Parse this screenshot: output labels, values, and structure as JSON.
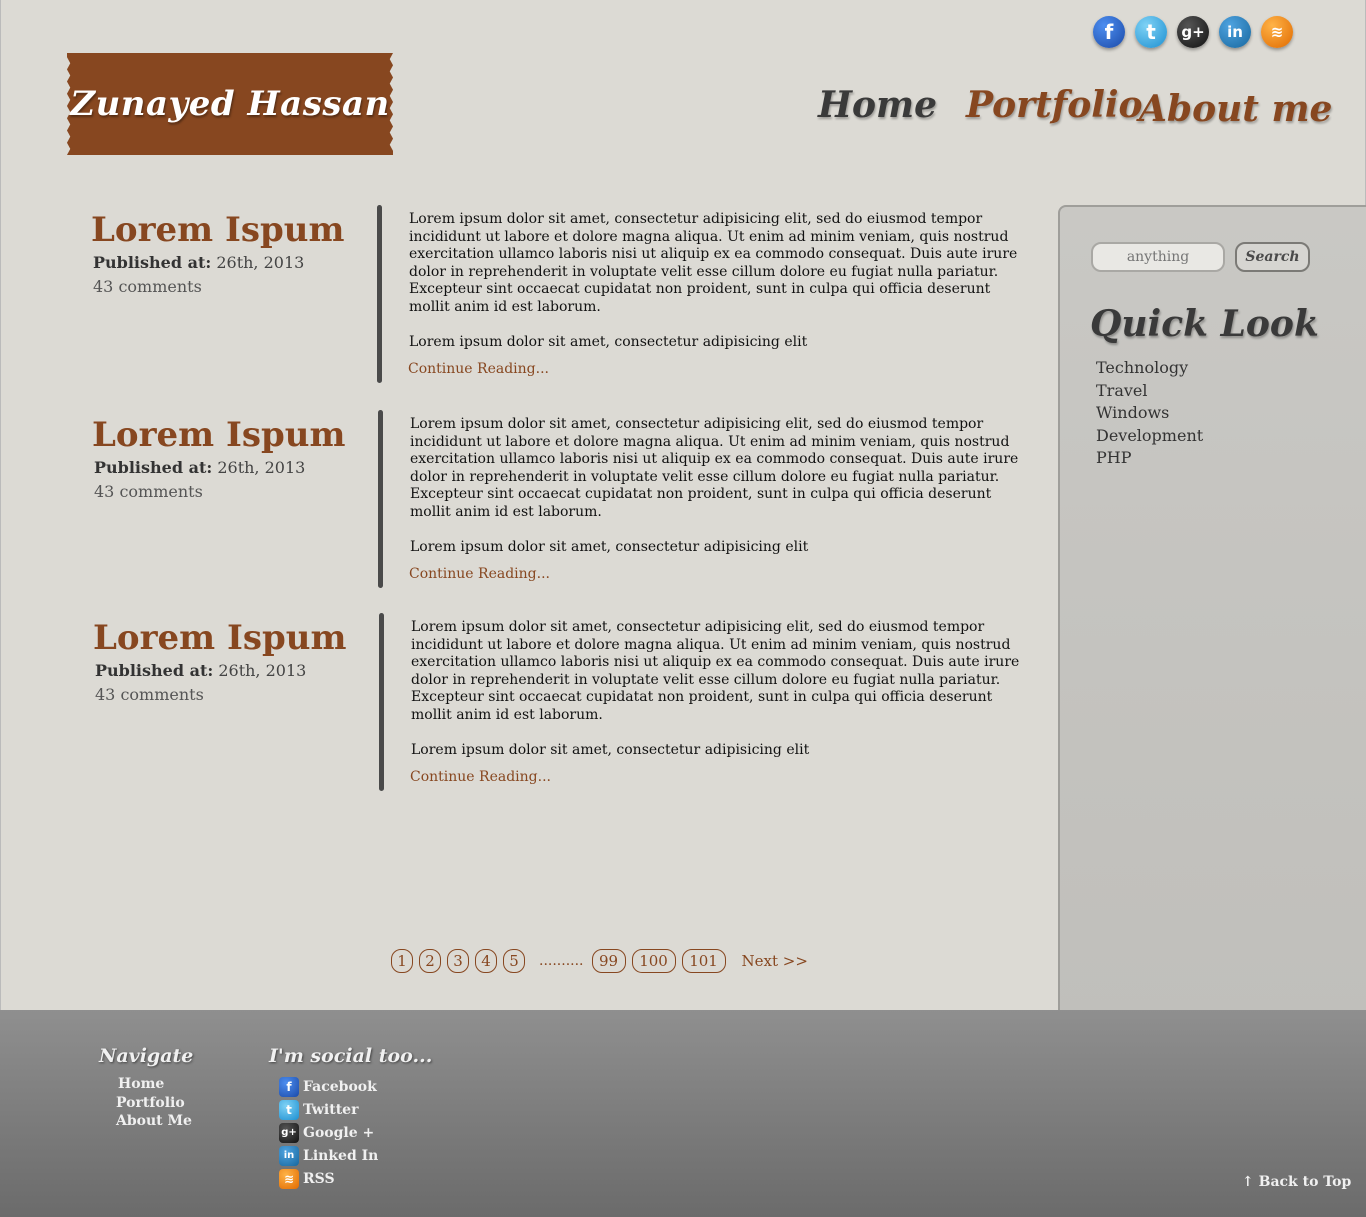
{
  "site": {
    "logo": "Zunayed Hassan"
  },
  "nav": {
    "home": "Home",
    "portfolio": "Portfolio",
    "about": "About me"
  },
  "social_top": [
    {
      "icon": "facebook-icon",
      "glyph": "f"
    },
    {
      "icon": "twitter-icon",
      "glyph": "t"
    },
    {
      "icon": "google-plus-icon",
      "glyph": "g+"
    },
    {
      "icon": "linkedin-icon",
      "glyph": "in"
    },
    {
      "icon": "rss-icon",
      "glyph": "≋"
    }
  ],
  "posts": [
    {
      "title": "Lorem Ispum",
      "published_label": "Published at:",
      "published_date": " 26th, 2013",
      "comments": "43 comments",
      "paragraph1": "Lorem ipsum dolor sit amet, consectetur adipisicing elit, sed do eiusmod tempor incididunt ut labore et dolore magna aliqua. Ut enim ad minim veniam, quis nostrud exercitation ullamco laboris nisi ut aliquip ex ea commodo consequat. Duis aute irure dolor in reprehenderit in voluptate velit esse cillum dolore eu fugiat nulla pariatur. Excepteur sint occaecat cupidatat non proident, sunt in culpa qui officia deserunt mollit anim id est laborum.",
      "paragraph2": "Lorem ipsum dolor sit amet, consectetur adipisicing elit",
      "more": "Continue Reading..."
    },
    {
      "title": "Lorem Ispum",
      "published_label": "Published at:",
      "published_date": " 26th, 2013",
      "comments": "43 comments",
      "paragraph1": "Lorem ipsum dolor sit amet, consectetur adipisicing elit, sed do eiusmod tempor incididunt ut labore et dolore magna aliqua. Ut enim ad minim veniam, quis nostrud exercitation ullamco laboris nisi ut aliquip ex ea commodo consequat. Duis aute irure dolor in reprehenderit in voluptate velit esse cillum dolore eu fugiat nulla pariatur. Excepteur sint occaecat cupidatat non proident, sunt in culpa qui officia deserunt mollit anim id est laborum.",
      "paragraph2": "Lorem ipsum dolor sit amet, consectetur adipisicing elit",
      "more": "Continue Reading..."
    },
    {
      "title": "Lorem Ispum",
      "published_label": "Published at:",
      "published_date": " 26th, 2013",
      "comments": "43 comments",
      "paragraph1": "Lorem ipsum dolor sit amet, consectetur adipisicing elit, sed do eiusmod tempor incididunt ut labore et dolore magna aliqua. Ut enim ad minim veniam, quis nostrud exercitation ullamco laboris nisi ut aliquip ex ea commodo consequat. Duis aute irure dolor in reprehenderit in voluptate velit esse cillum dolore eu fugiat nulla pariatur. Excepteur sint occaecat cupidatat non proident, sunt in culpa qui officia deserunt mollit anim id est laborum.",
      "paragraph2": "Lorem ipsum dolor sit amet, consectetur adipisicing elit",
      "more": "Continue Reading..."
    }
  ],
  "sidebar": {
    "search_placeholder": "anything",
    "search_button": "Search",
    "quick_look_title": "Quick Look",
    "categories": [
      "Technology",
      "Travel",
      "Windows",
      "Development",
      "PHP"
    ]
  },
  "pagination": {
    "pages_start": [
      "1",
      "2",
      "3",
      "4",
      "5"
    ],
    "dots": "..........",
    "pages_end": [
      "99",
      "100",
      "101"
    ],
    "next": "Next >>"
  },
  "footer": {
    "navigate_title": "Navigate",
    "navigate_items": [
      "Home",
      "Portfolio",
      "About Me"
    ],
    "social_title": "I'm social too...",
    "social_items": [
      {
        "label": "Facebook",
        "icon": "facebook-icon"
      },
      {
        "label": "Twitter",
        "icon": "twitter-icon"
      },
      {
        "label": "Google +",
        "icon": "google-plus-icon"
      },
      {
        "label": "Linked In",
        "icon": "linkedin-icon"
      },
      {
        "label": "RSS",
        "icon": "rss-icon"
      }
    ],
    "back_to_top": "Back to Top"
  },
  "colors": {
    "brand_brown": "#874720",
    "page_bg": "#dcdad4",
    "footer_grey": "#7a7a7a"
  }
}
